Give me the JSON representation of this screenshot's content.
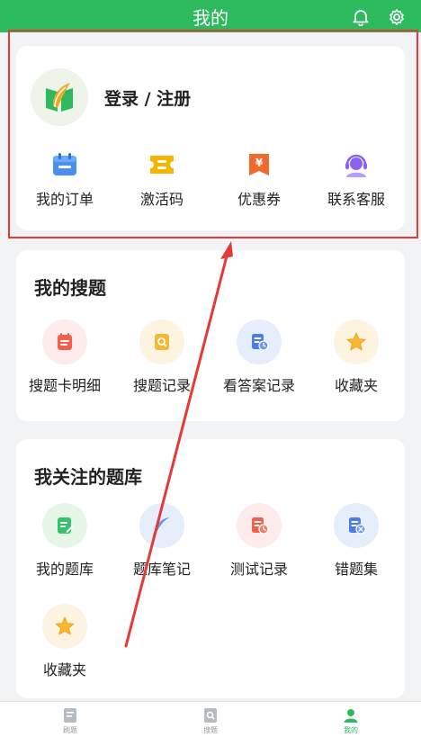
{
  "header": {
    "title": "我的"
  },
  "profile": {
    "login_label": "登录 / 注册"
  },
  "quick_menu": [
    {
      "label": "我的订单",
      "icon": "calendar-icon"
    },
    {
      "label": "激活码",
      "icon": "ticket-icon"
    },
    {
      "label": "优惠券",
      "icon": "yen-coupon-icon"
    },
    {
      "label": "联系客服",
      "icon": "headset-agent-icon"
    }
  ],
  "my_search": {
    "title": "我的搜题",
    "items": [
      {
        "label": "搜题卡明细",
        "icon": "list-card-icon"
      },
      {
        "label": "搜题记录",
        "icon": "search-doc-icon"
      },
      {
        "label": "看答案记录",
        "icon": "doc-clock-icon"
      },
      {
        "label": "收藏夹",
        "icon": "star-icon"
      }
    ]
  },
  "my_banks": {
    "title": "我关注的题库",
    "items": [
      {
        "label": "我的题库",
        "icon": "edit-doc-icon"
      },
      {
        "label": "题库笔记",
        "icon": "feather-icon"
      },
      {
        "label": "测试记录",
        "icon": "doc-clock-icon"
      },
      {
        "label": "错题集",
        "icon": "doc-x-icon"
      },
      {
        "label": "收藏夹",
        "icon": "star-icon"
      }
    ]
  },
  "tabbar": [
    {
      "label": "刷题",
      "icon": "doc-tab-icon",
      "active": false
    },
    {
      "label": "搜题",
      "icon": "search-tab-icon",
      "active": false
    },
    {
      "label": "我的",
      "icon": "person-icon",
      "active": true
    }
  ],
  "colors": {
    "brand": "#2dba5e",
    "annotation": "#e53935"
  }
}
